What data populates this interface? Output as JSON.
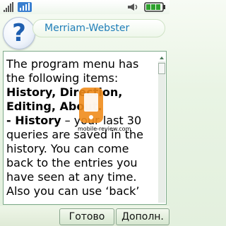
{
  "statusbar": {
    "signal_icon": "signal-strength-icon",
    "network_icon": "network-data-icon",
    "speaker_icon": "speaker-icon",
    "battery_icon": "battery-icon"
  },
  "header": {
    "icon": "question-mark-icon",
    "icon_glyph": "?",
    "title": "Merriam-Webster"
  },
  "content": {
    "intro": "The program menu has the following items: ",
    "items_bold": "History, Direction, Editing,  About.",
    "history_label": "- History",
    "history_text": " – your last 30 queries are saved in the history. You can come back to the entries you have seen at any time. Also you can use ‘back’"
  },
  "watermark": {
    "text": "mobile-review.com",
    "icon": "watermark-logo-icon"
  },
  "softkeys": {
    "left": "Готово",
    "right": "Дополн."
  },
  "colors": {
    "accent": "#1e7db8",
    "help_icon": "#1f5fb0",
    "battery": "#2ea02e",
    "background": "#e9f4e4"
  }
}
